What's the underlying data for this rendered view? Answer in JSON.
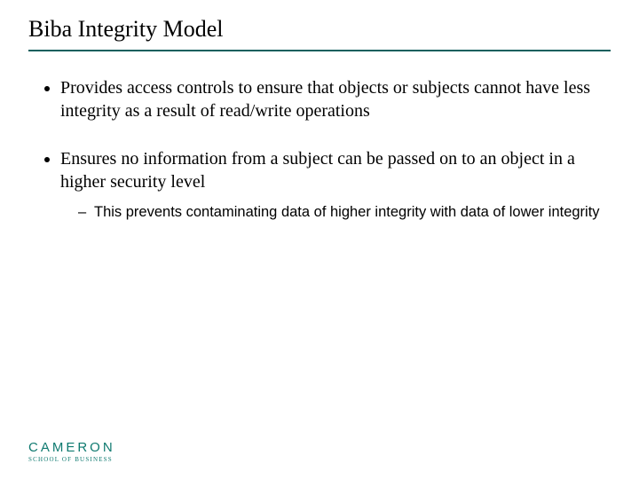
{
  "title": "Biba Integrity Model",
  "bullets": [
    {
      "text": "Provides access controls to ensure that objects or subjects cannot have less integrity as a result of read/write operations",
      "children": []
    },
    {
      "text": "Ensures no information from a subject can be passed on to an object in a higher security level",
      "children": [
        "This prevents contaminating data of higher integrity with data of lower integrity"
      ]
    }
  ],
  "logo": {
    "name": "CAMERON",
    "sub": "School of Business"
  }
}
